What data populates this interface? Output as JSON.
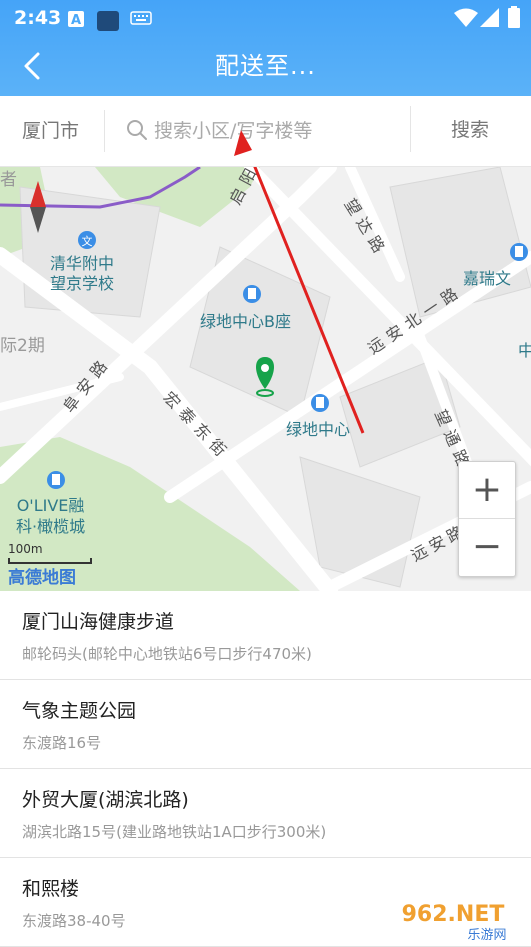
{
  "status": {
    "time": "2:43"
  },
  "header": {
    "title": "配送至..."
  },
  "search": {
    "city": "厦门市",
    "placeholder": "搜索小区/写字楼等",
    "button": "搜索"
  },
  "map": {
    "labels": {
      "school": "清华附中\n望京学校",
      "building_b": "绿地中心B座",
      "greenland": "绿地中心",
      "jiarui": "嘉瑞文",
      "olive": "O'LIVE融\n科·橄榄城",
      "phase2": "际2期",
      "zhe": "者",
      "zhong": "中",
      "qiyang": "启阳路",
      "wangda": "望达路",
      "yuananbei": "远安北一路",
      "fuan": "阜安路",
      "hongtai": "宏泰东街",
      "wangtong": "望通路",
      "yuanan": "远安路"
    },
    "scale": "100m",
    "logo": "高德地图",
    "zoom_in": "+",
    "zoom_out": "−"
  },
  "results": [
    {
      "name": "厦门山海健康步道",
      "address": "邮轮码头(邮轮中心地铁站6号口步行470米)"
    },
    {
      "name": "气象主题公园",
      "address": "东渡路16号"
    },
    {
      "name": "外贸大厦(湖滨北路)",
      "address": "湖滨北路15号(建业路地铁站1A口步行300米)"
    },
    {
      "name": "和熙楼",
      "address": "东渡路38-40号"
    }
  ],
  "watermark": {
    "text": "962.NET",
    "sub": "乐游网"
  },
  "colors": {
    "header": "#4aa8f8",
    "route": "#8a5cc8",
    "pin": "#16a34a",
    "arrow": "#e0211f"
  }
}
